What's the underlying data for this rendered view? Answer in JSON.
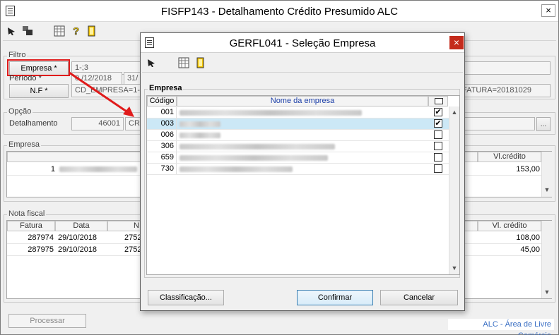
{
  "main_window": {
    "title": "FISFP143 - Detalhamento Crédito Presumido ALC",
    "close_label": "×",
    "filtro": {
      "group_label": "Filtro",
      "empresa_button": "Empresa *",
      "empresa_value": "1-;3",
      "periodo_label": "Período *",
      "periodo_start": "0 /12/2018",
      "periodo_end": "31/",
      "nf_button": "N.F *",
      "nf_value": "CD_EMPRESA=1-!-;3",
      "nf_value_right": "FATURA=20181029"
    },
    "opcao": {
      "group_label": "Opção",
      "detalhamento_label": "Detalhamento",
      "detalhamento_code": "46001",
      "detalhamento_text": "CRE",
      "lookup_label": "…"
    },
    "empresa_grid": {
      "group_label": "Empresa",
      "col_vl_credito": "Vl.crédito",
      "rows": [
        {
          "codigo": "1",
          "vl_credito": "153,00"
        }
      ]
    },
    "nota_fiscal_grid": {
      "group_label": "Nota fiscal",
      "columns": [
        "Fatura",
        "Data",
        "N.",
        "Vl. crédito"
      ],
      "rows": [
        {
          "fatura": "287974",
          "data": "29/10/2018",
          "n": "2752",
          "vl_credito": "108,00"
        },
        {
          "fatura": "287975",
          "data": "29/10/2018",
          "n": "2752",
          "vl_credito": "45,00"
        }
      ]
    },
    "processar_button": "Processar",
    "footer_text": "ALC - Área de Livre Comércio"
  },
  "dialog": {
    "title": "GERFL041 - Seleção Empresa",
    "close_label": "×",
    "group_label": "Empresa",
    "columns": {
      "codigo": "Código",
      "nome": "Nome da empresa"
    },
    "rows": [
      {
        "codigo": "001",
        "checked": "✔"
      },
      {
        "codigo": "003",
        "checked": "✔"
      },
      {
        "codigo": "006",
        "checked": ""
      },
      {
        "codigo": "306",
        "checked": ""
      },
      {
        "codigo": "659",
        "checked": ""
      },
      {
        "codigo": "730",
        "checked": ""
      }
    ],
    "buttons": {
      "classificacao": "Classificação...",
      "confirmar": "Confirmar",
      "cancelar": "Cancelar"
    }
  },
  "colors": {
    "highlight_box": "#e01b1b",
    "arrow": "#e01b1b",
    "selected_row": "#cce8f6",
    "footer_text": "#3a6fc4"
  }
}
